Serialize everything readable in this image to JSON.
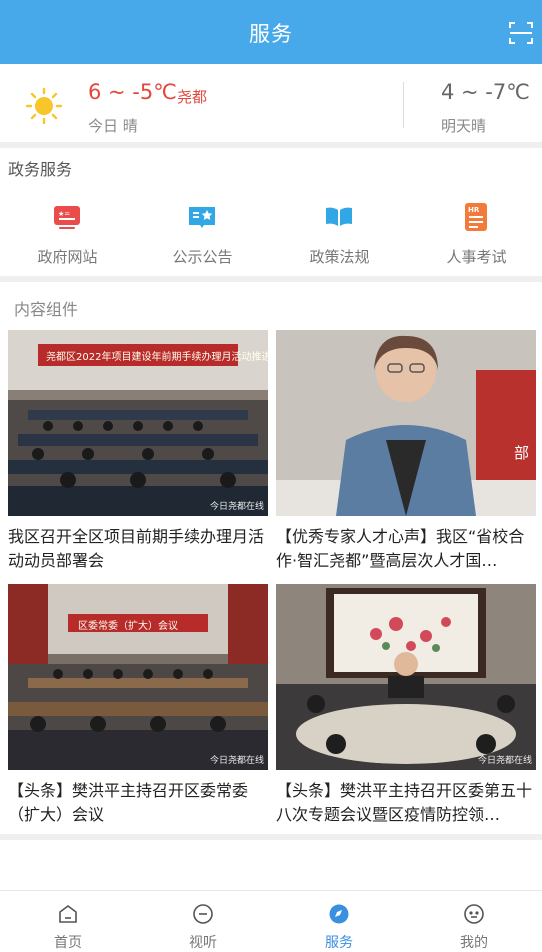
{
  "header": {
    "title": "服务"
  },
  "weather": {
    "today_temp": "6 ~ -5℃",
    "city": "尧都",
    "today_desc": "今日 晴",
    "tomorrow_temp": "4 ~ -7℃",
    "tomorrow_desc": "明天晴"
  },
  "gov_section": {
    "title": "政务服务",
    "items": [
      {
        "label": "政府网站",
        "icon": "gov-website-icon",
        "color": "#ea4c4c"
      },
      {
        "label": "公示公告",
        "icon": "notice-icon",
        "color": "#31a7e6"
      },
      {
        "label": "政策法规",
        "icon": "book-icon",
        "color": "#31a7e6"
      },
      {
        "label": "人事考试",
        "icon": "hr-exam-icon",
        "color": "#f27a3a"
      }
    ]
  },
  "content_section": {
    "title": "内容组件",
    "cards": [
      {
        "title": "我区召开全区项目前期手续办理月活动动员部署会",
        "watermark": "今日尧都在线",
        "banner": "尧都区2022年项目建设年前期手续办理月活动推进会"
      },
      {
        "title": "【优秀专家人才心声】我区“省校合作·智汇尧都”暨高层次人才国…",
        "watermark": "",
        "banner": "部"
      },
      {
        "title": "【头条】樊洪平主持召开区委常委（扩大）会议",
        "watermark": "今日尧都在线",
        "banner": "区委常委（扩大）会议"
      },
      {
        "title": "【头条】樊洪平主持召开区委第五十八次专题会议暨区疫情防控领…",
        "watermark": "今日尧都在线",
        "banner": ""
      }
    ]
  },
  "tabbar": {
    "tabs": [
      {
        "label": "首页",
        "icon": "home-icon"
      },
      {
        "label": "视听",
        "icon": "media-icon"
      },
      {
        "label": "服务",
        "icon": "service-icon",
        "active": true
      },
      {
        "label": "我的",
        "icon": "profile-icon"
      }
    ]
  },
  "colors": {
    "header": "#47a8ea",
    "accent": "#3a8fe0",
    "temp_today": "#e2473c"
  }
}
